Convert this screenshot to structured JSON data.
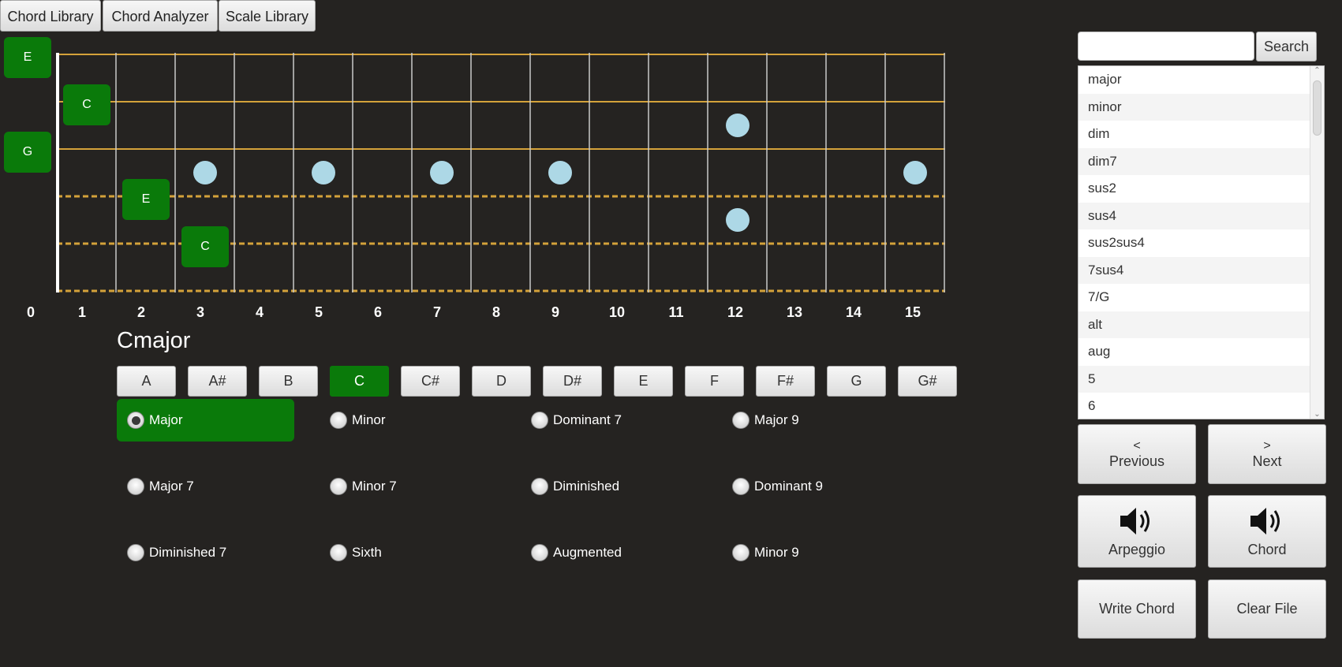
{
  "tabs": [
    {
      "label": "Chord Library"
    },
    {
      "label": "Chord Analyzer"
    },
    {
      "label": "Scale Library"
    }
  ],
  "fretboard": {
    "fret_numbers": [
      "0",
      "1",
      "2",
      "3",
      "4",
      "5",
      "6",
      "7",
      "8",
      "9",
      "10",
      "11",
      "12",
      "13",
      "14",
      "15"
    ],
    "open_notes": [
      "E",
      "G"
    ],
    "chord_notes": [
      "C",
      "E",
      "C"
    ],
    "inlay_color": "#add8e6",
    "string_color": "#d4a23a",
    "note_color": "#0a7a0a"
  },
  "chord_title": "Cmajor",
  "roots": {
    "items": [
      "A",
      "A#",
      "B",
      "C",
      "C#",
      "D",
      "D#",
      "E",
      "F",
      "F#",
      "G",
      "G#"
    ],
    "selected": "C"
  },
  "chord_types": {
    "items": [
      "Major",
      "Minor",
      "Dominant 7",
      "Major 9",
      "Major 7",
      "Minor 7",
      "Diminished",
      "Dominant 9",
      "Diminished 7",
      "Sixth",
      "Augmented",
      "Minor 9"
    ],
    "selected": "Major"
  },
  "search": {
    "placeholder": "",
    "button_label": "Search"
  },
  "chord_list": [
    "major",
    "minor",
    "dim",
    "dim7",
    "sus2",
    "sus4",
    "sus2sus4",
    "7sus4",
    "7/G",
    "alt",
    "aug",
    "5",
    "6"
  ],
  "buttons": {
    "previous_symbol": "<",
    "previous_label": "Previous",
    "next_symbol": ">",
    "next_label": "Next",
    "arpeggio_label": "Arpeggio",
    "chord_label": "Chord",
    "write_chord_label": "Write Chord",
    "clear_file_label": "Clear File"
  }
}
